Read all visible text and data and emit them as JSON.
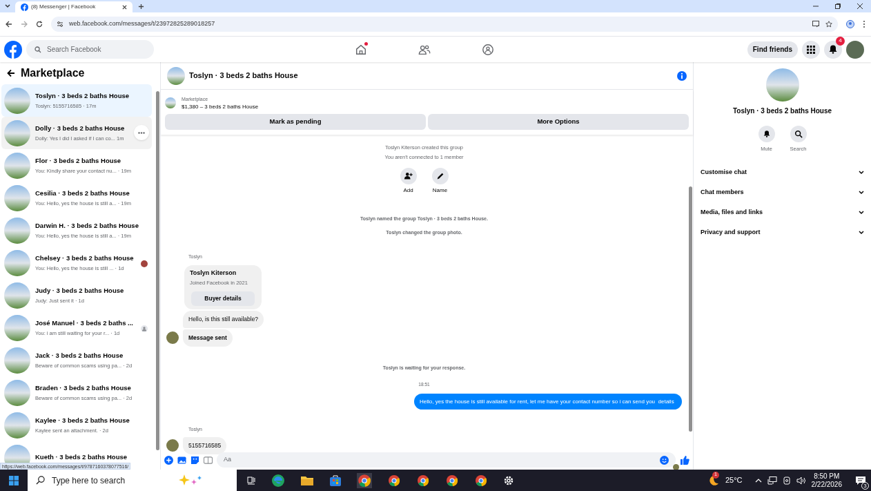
{
  "browser": {
    "tab_title": "(8) Messenger | Facebook",
    "url": "web.facebook.com/messages/t/23972825289018257"
  },
  "header": {
    "search_placeholder": "Search Facebook",
    "nav": [
      {
        "kind": "home",
        "selected": false,
        "dot": true
      },
      {
        "kind": "friends",
        "selected": false,
        "dot": false
      },
      {
        "kind": "groups",
        "selected": false,
        "dot": false
      }
    ],
    "find_friends": "Find friends",
    "notification_count": "4"
  },
  "sidebar": {
    "title": "Marketplace",
    "conversations": [
      {
        "name": "Toslyn · 3 beds 2 baths House",
        "preview": "Toslyn: 5155716585 · 17m",
        "selected": true,
        "hovered": false
      },
      {
        "name": "Dolly · 3 beds 2 baths House",
        "preview": "Dolly: Yes I did I asked if I can co... 1m",
        "selected": false,
        "hovered": true
      },
      {
        "name": "Flor · 3 beds 2 baths House",
        "preview": "You: Kindly share your contact nu... · 19m",
        "selected": false,
        "hovered": false
      },
      {
        "name": "Cesilia · 3 beds 2 baths House",
        "preview": "You: Hello, yes the house is still a... · 19m",
        "selected": false,
        "hovered": false
      },
      {
        "name": "Darwin H. · 3 beds 2 baths House",
        "preview": "You: Hello, yes the house is still a... · 19m",
        "selected": false,
        "hovered": false
      },
      {
        "name": "Chelsey · 3 beds 2 baths House",
        "preview": "You: Hello, yes the house is still ... · 1d",
        "selected": false,
        "hovered": false,
        "avatar_receipt": true
      },
      {
        "name": "Judy · 3 beds 2 baths House",
        "preview": "Judy: Just sent it · 1d",
        "selected": false,
        "hovered": false
      },
      {
        "name": "José Manuel · 3 beds 2 baths ...",
        "preview": "You: i am still waiting for your r... · 1d",
        "selected": false,
        "hovered": false,
        "person_receipt": true
      },
      {
        "name": "Jack · 3 beds 2 baths House",
        "preview": "Beware of common scams using pa... · 2d",
        "selected": false,
        "hovered": false
      },
      {
        "name": "Braden · 3 beds 2 baths House",
        "preview": "Beware of common scams using pa... · 2d",
        "selected": false,
        "hovered": false
      },
      {
        "name": "Kaylee · 3 beds 2 baths House",
        "preview": "Kaylee sent an attachment. · 2d",
        "selected": false,
        "hovered": false
      },
      {
        "name": "Kueth · 3 beds 2 baths House",
        "selected": false,
        "hovered": false
      }
    ],
    "status_url": "https://web.facebook.com/messages/t/9787160378077516/"
  },
  "chat": {
    "title": "Toslyn · 3 beds 2 baths House",
    "listing": {
      "label": "Marketplace",
      "title": "$1,380 – 3 beds 2 baths House"
    },
    "buttons": [
      "Mark as pending",
      "More Options"
    ],
    "messages": [
      {
        "kind": "info",
        "text": "Toslyn Kiterson created this group"
      },
      {
        "kind": "info",
        "text": "You aren't connected to 1 member"
      },
      {
        "kind": "actions",
        "items": [
          {
            "kind": "add",
            "label": "Add"
          },
          {
            "kind": "name",
            "label": "Name"
          }
        ]
      },
      {
        "kind": "notice",
        "text": "Toslyn named the group Toslyn · 3 beds 2 baths House."
      },
      {
        "kind": "notice",
        "text": "Toslyn changed the group photo."
      },
      {
        "kind": "sender",
        "text": "Toslyn"
      },
      {
        "kind": "card",
        "name": "Toslyn Kiterson",
        "subtitle": "Joined Facebook in 2021",
        "button": "Buyer details"
      },
      {
        "kind": "incoming",
        "text": "Hello, is this still available?",
        "avatar": false,
        "bold": false
      },
      {
        "kind": "incoming",
        "text": "Message sent",
        "avatar": true,
        "bold": true
      },
      {
        "kind": "notice",
        "text": "Toslyn is waiting for your response."
      },
      {
        "kind": "time",
        "text": "18:51"
      },
      {
        "kind": "outgoing",
        "text": "Hello, yes the house is still available for rent, let me have your contact number so i can send you  details"
      },
      {
        "kind": "sender",
        "text": "Toslyn"
      },
      {
        "kind": "incoming",
        "text": "5155716585",
        "avatar": true,
        "bold": false
      }
    ],
    "composer_placeholder": "Aa"
  },
  "details": {
    "title": "Toslyn · 3 beds 2 baths House",
    "actions": [
      {
        "kind": "mute",
        "label": "Mute"
      },
      {
        "kind": "search",
        "label": "Search"
      }
    ],
    "sections": [
      {
        "label": "Customise chat",
        "expanded": false
      },
      {
        "label": "Chat members",
        "expanded": false
      },
      {
        "label": "Media, files and links",
        "expanded": false
      },
      {
        "label": "Privacy and support",
        "expanded": false
      }
    ]
  },
  "taskbar": {
    "search_placeholder": "Type here to search",
    "weather_badge": "1",
    "temperature": "25°C",
    "time": "8:50 PM",
    "date": "2/22/2026",
    "notification_count": "3"
  }
}
